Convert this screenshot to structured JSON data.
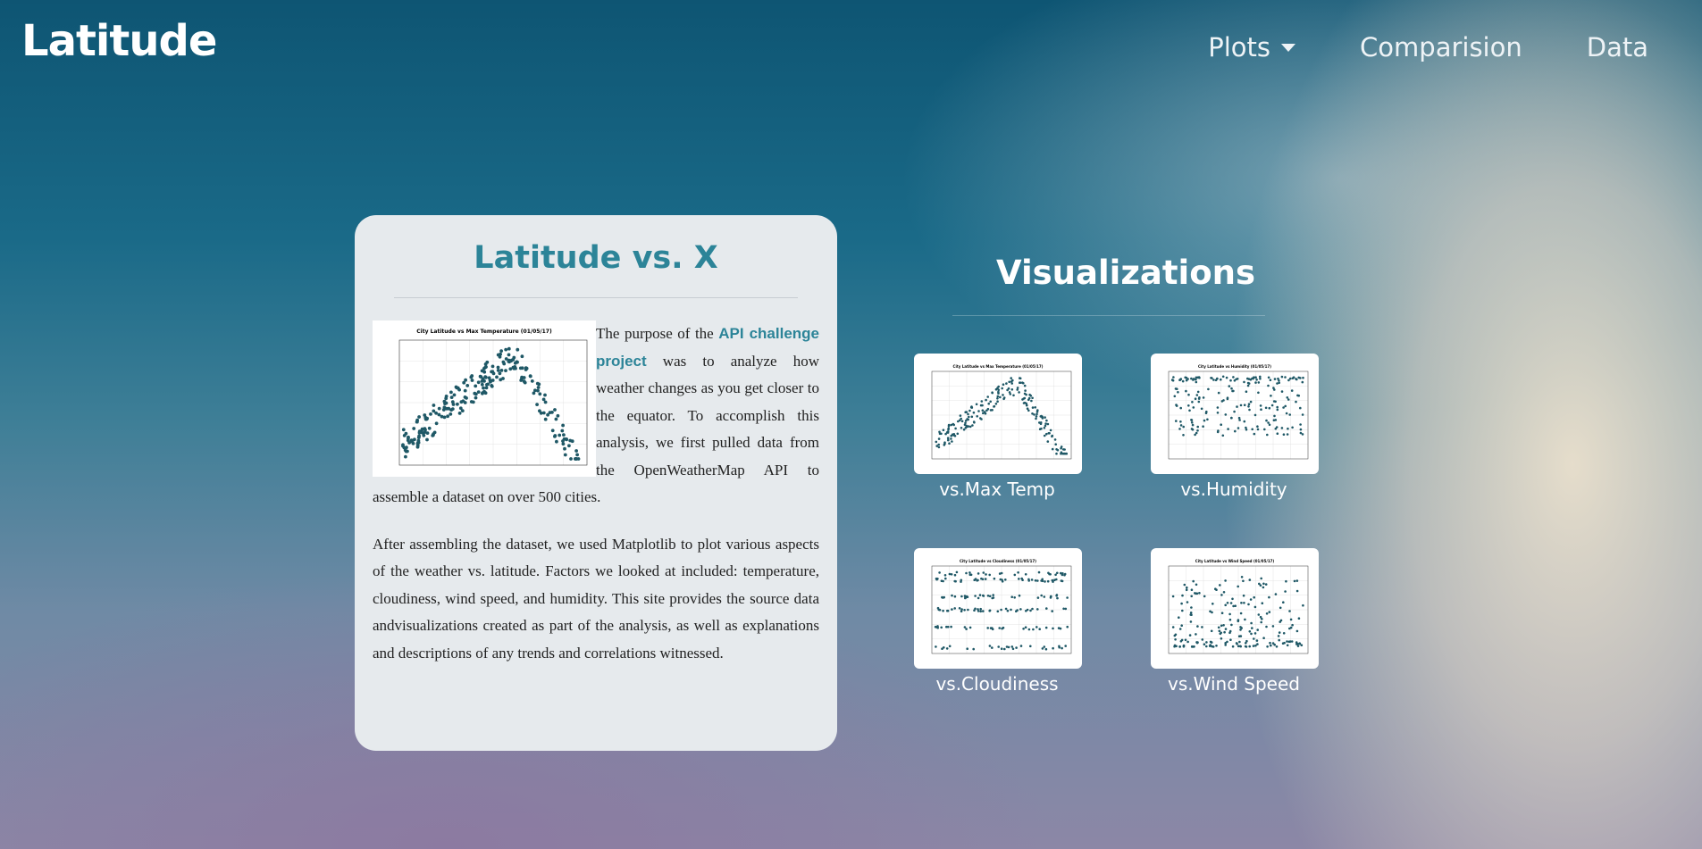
{
  "brand": "Latitude",
  "nav": {
    "plots": "Plots",
    "comparison": "Comparision",
    "data": "Data"
  },
  "card": {
    "title": "Latitude vs. X",
    "image_title": "City Latitude vs Max Temperature (01/05/17)",
    "para1_before": "The purpose of the ",
    "para1_link": "API challenge project",
    "para1_after": " was to analyze how weather changes as you get closer to the equator. To accomplish this analysis, we first pulled data from the OpenWeatherMap API to assemble a dataset on over 500 cities.",
    "para2": "After assembling the dataset, we used Matplotlib to plot various aspects of the weather vs. latitude. Factors we looked at included: temperature, cloudiness, wind speed, and humidity. This site provides the source data andvisualizations created as part of the analysis, as well as explanations and descriptions of any trends and correlations witnessed."
  },
  "visualizations": {
    "title": "Visualizations",
    "items": [
      {
        "label": "vs.Max Temp",
        "plot_title": "City Latitude vs Max Temperature (01/05/17)"
      },
      {
        "label": "vs.Humidity",
        "plot_title": "City Latitude vs Humidity (01/05/17)"
      },
      {
        "label": "vs.Cloudiness",
        "plot_title": "City Latitude vs Cloudiness (01/05/17)"
      },
      {
        "label": "vs.Wind Speed",
        "plot_title": "City Latitude vs Wind Speed (01/05/17)"
      }
    ]
  },
  "colors": {
    "accent": "#2c8498",
    "point": "#1f5866",
    "card_bg": "#e6eaed"
  }
}
